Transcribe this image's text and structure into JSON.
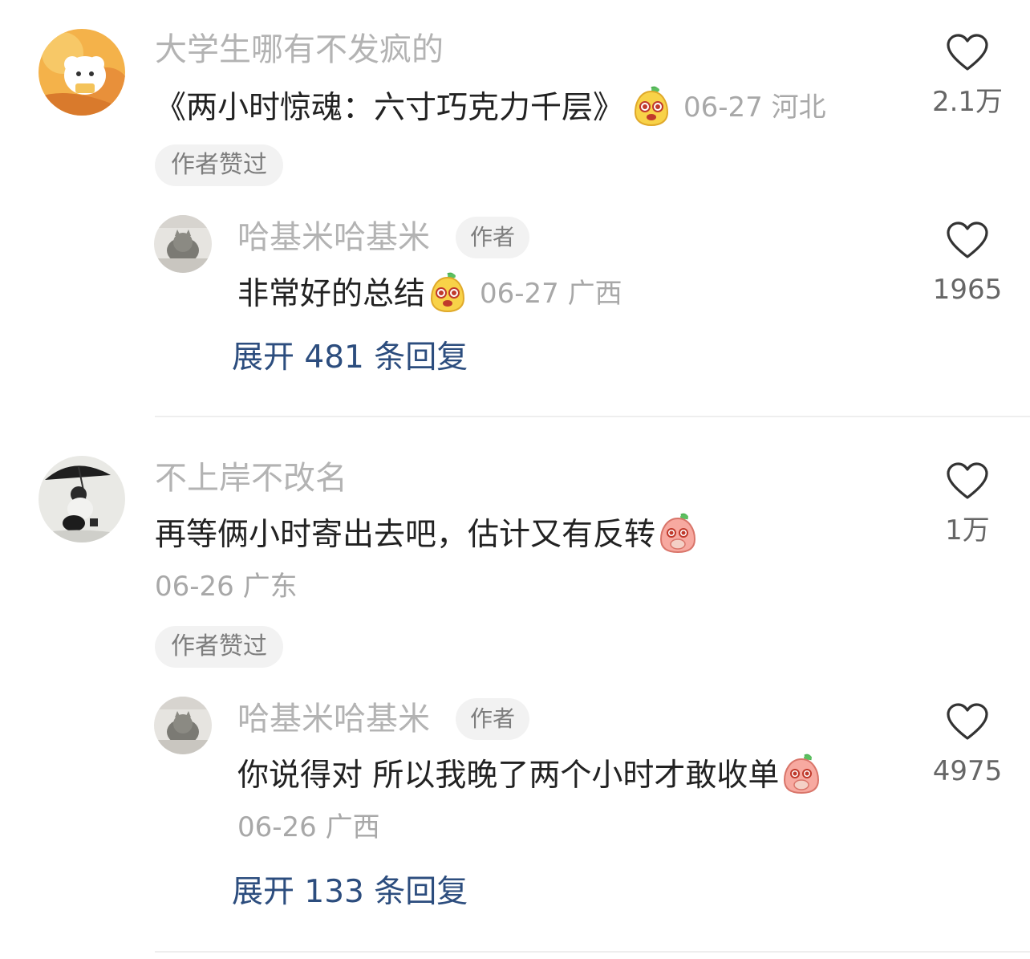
{
  "comments": [
    {
      "username": "大学生哪有不发疯的",
      "text": "《两小时惊魂：六寸巧克力千层》",
      "emoji_icon": "pear-face-emoji-icon",
      "meta": "06-27 河北",
      "badge": "作者赞过",
      "likes": "2.1万",
      "reply": {
        "username": "哈基米哈基米",
        "author_tag": "作者",
        "text": "非常好的总结",
        "emoji_icon": "pear-face-emoji-icon",
        "meta": "06-27 广西",
        "likes": "1965"
      },
      "expand_label": "展开 481 条回复"
    },
    {
      "username": "不上岸不改名",
      "text": "再等俩小时寄出去吧，估计又有反转",
      "emoji_icon": "peach-covering-mouth-emoji-icon",
      "meta": "06-26 广东",
      "badge": "作者赞过",
      "likes": "1万",
      "reply": {
        "username": "哈基米哈基米",
        "author_tag": "作者",
        "text": "你说得对 所以我晚了两个小时才敢收单",
        "emoji_icon": "peach-covering-mouth-emoji-icon",
        "meta": "06-26 广西",
        "likes": "4975"
      },
      "expand_label": "展开 133 条回复"
    }
  ],
  "colors": {
    "username": "#b3b3b3",
    "text": "#222222",
    "meta": "#a8a8a8",
    "link": "#2c4d7e",
    "badge_bg": "#f2f2f2"
  }
}
